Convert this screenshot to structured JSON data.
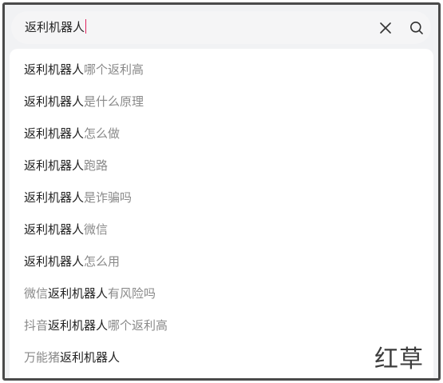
{
  "search": {
    "query": "返利机器人"
  },
  "suggestions": [
    {
      "prefix": "",
      "keyword": "返利机器人",
      "suffix": "哪个返利高"
    },
    {
      "prefix": "",
      "keyword": "返利机器人",
      "suffix": "是什么原理"
    },
    {
      "prefix": "",
      "keyword": "返利机器人",
      "suffix": "怎么做"
    },
    {
      "prefix": "",
      "keyword": "返利机器人",
      "suffix": "跑路"
    },
    {
      "prefix": "",
      "keyword": "返利机器人",
      "suffix": "是诈骗吗"
    },
    {
      "prefix": "",
      "keyword": "返利机器人",
      "suffix": "微信"
    },
    {
      "prefix": "",
      "keyword": "返利机器人",
      "suffix": "怎么用"
    },
    {
      "prefix": "微信",
      "keyword": "返利机器人",
      "suffix": "有风险吗"
    },
    {
      "prefix": "抖音",
      "keyword": "返利机器人",
      "suffix": "哪个返利高"
    },
    {
      "prefix": "万能猪",
      "keyword": "返利机器人",
      "suffix": ""
    }
  ],
  "watermark": {
    "text": "红草"
  },
  "icons": {
    "clear": "close-icon",
    "search": "search-icon"
  },
  "colors": {
    "caret": "#e0245e",
    "highlight_text": "#222222",
    "secondary_text": "#8a8a8a",
    "accent_line": "#ff9f5a"
  }
}
